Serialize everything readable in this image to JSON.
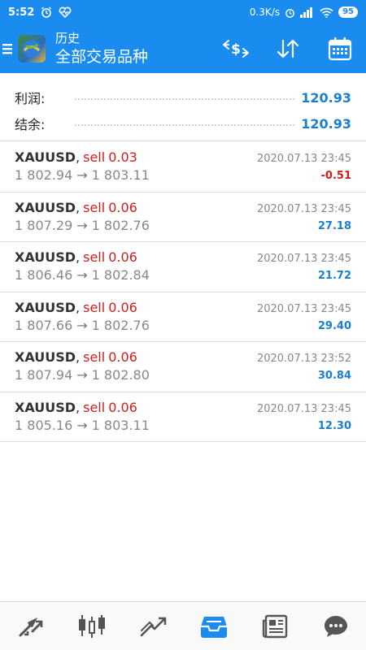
{
  "status_bar": {
    "time": "5:52",
    "network_speed": "0.3K/s",
    "network_type": "4G",
    "battery": "95"
  },
  "app_bar": {
    "title_top": "历史",
    "title_bottom": "全部交易品种"
  },
  "summary": {
    "profit_label": "利润:",
    "profit_value": "120.93",
    "balance_label": "结余:",
    "balance_value": "120.93"
  },
  "trades": [
    {
      "symbol": "XAUUSD",
      "side": "sell",
      "volume": "0.03",
      "open_price": "1 802.94",
      "close_price": "1 803.11",
      "time": "2020.07.13 23:45",
      "profit": "-0.51"
    },
    {
      "symbol": "XAUUSD",
      "side": "sell",
      "volume": "0.06",
      "open_price": "1 807.29",
      "close_price": "1 802.76",
      "time": "2020.07.13 23:45",
      "profit": "27.18"
    },
    {
      "symbol": "XAUUSD",
      "side": "sell",
      "volume": "0.06",
      "open_price": "1 806.46",
      "close_price": "1 802.84",
      "time": "2020.07.13 23:45",
      "profit": "21.72"
    },
    {
      "symbol": "XAUUSD",
      "side": "sell",
      "volume": "0.06",
      "open_price": "1 807.66",
      "close_price": "1 802.76",
      "time": "2020.07.13 23:45",
      "profit": "29.40"
    },
    {
      "symbol": "XAUUSD",
      "side": "sell",
      "volume": "0.06",
      "open_price": "1 807.94",
      "close_price": "1 802.80",
      "time": "2020.07.13 23:52",
      "profit": "30.84"
    },
    {
      "symbol": "XAUUSD",
      "side": "sell",
      "volume": "0.06",
      "open_price": "1 805.16",
      "close_price": "1 803.11",
      "time": "2020.07.13 23:45",
      "profit": "12.30"
    }
  ],
  "bottom_nav": [
    {
      "icon": "quotes-icon",
      "active": false
    },
    {
      "icon": "chart-icon",
      "active": false
    },
    {
      "icon": "trade-icon",
      "active": false
    },
    {
      "icon": "history-icon",
      "active": true
    },
    {
      "icon": "news-icon",
      "active": false
    },
    {
      "icon": "chat-icon",
      "active": false
    }
  ],
  "colors": {
    "primary_blue": "#1a8cf0",
    "profit_blue": "#1a7fd0",
    "loss_red": "#d01d1d",
    "nav_active": "#1a8cf0",
    "nav_inactive": "#555555"
  }
}
